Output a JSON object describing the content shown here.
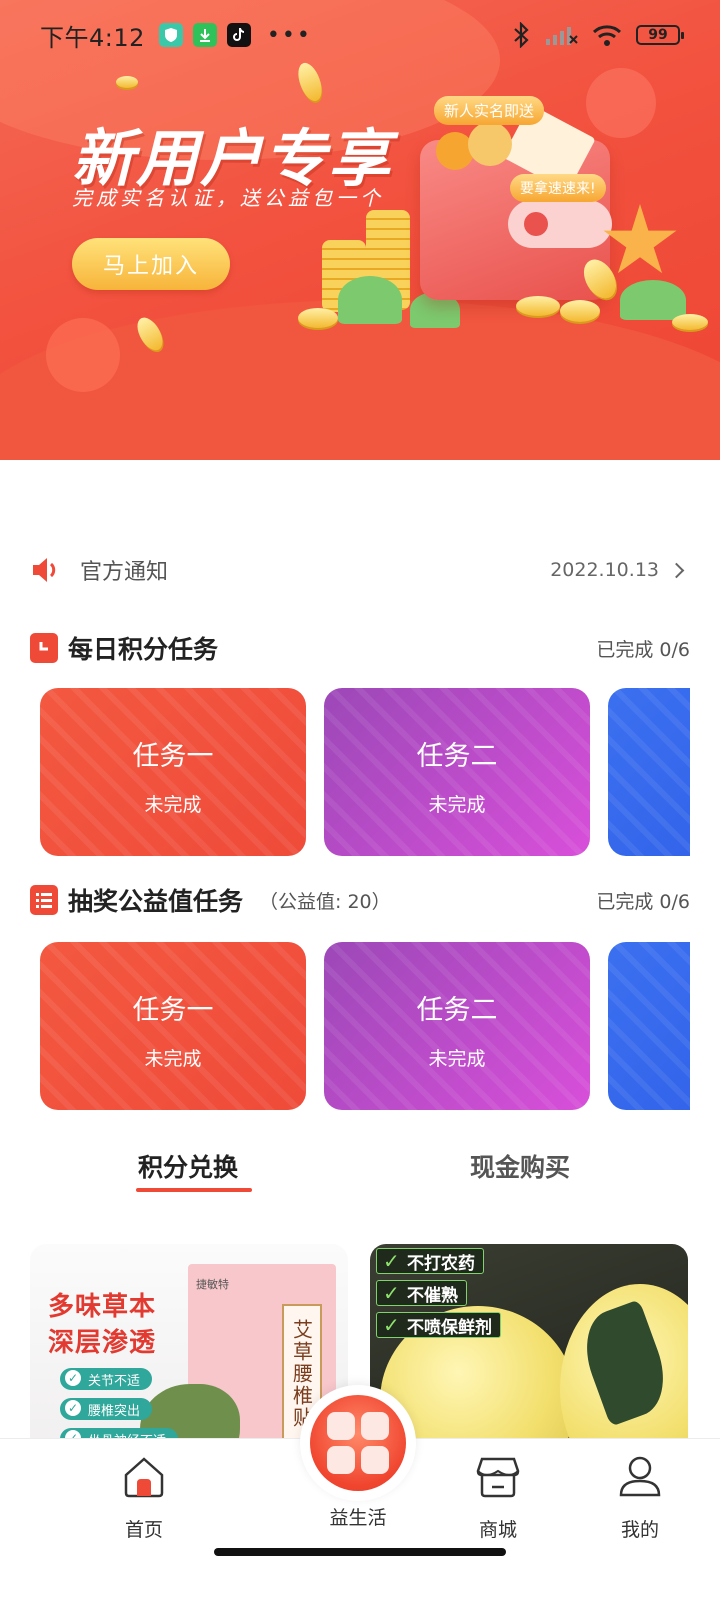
{
  "status_bar": {
    "time": "下午4:12",
    "battery": "99"
  },
  "banner": {
    "title": "新用户专享",
    "subtitle": "完成实名认证，送公益包一个",
    "join_button": "马上加入",
    "tag_new": "新人实名即送",
    "tag_hurry": "要拿速速来!",
    "colors": {
      "primary": "#ef4a38",
      "button": "#f7b43a"
    }
  },
  "notice": {
    "label": "官方通知",
    "date": "2022.10.13"
  },
  "daily_tasks": {
    "title": "每日积分任务",
    "done": "已完成 0/6",
    "cards": [
      {
        "title": "任务一",
        "status": "未完成",
        "color": "#ef4b3a"
      },
      {
        "title": "任务二",
        "status": "未完成",
        "color": "#b94bc9"
      },
      {
        "title": "",
        "status": "",
        "color": "#3b70f0"
      }
    ]
  },
  "lottery_tasks": {
    "title": "抽奖公益值任务",
    "extra": "（公益值: 20）",
    "done": "已完成 0/6",
    "cards": [
      {
        "title": "任务一",
        "status": "未完成",
        "color": "#ef4b3a"
      },
      {
        "title": "任务二",
        "status": "未完成",
        "color": "#b94bc9"
      },
      {
        "title": "",
        "status": "",
        "color": "#3b70f0"
      }
    ]
  },
  "tabs": [
    {
      "label": "积分兑换",
      "active": true
    },
    {
      "label": "现金购买",
      "active": false
    }
  ],
  "products": [
    {
      "headline1": "多味草本",
      "headline2": "深层渗透",
      "features": [
        "关节不适",
        "腰椎突出",
        "坐骨神经不适"
      ],
      "brand": "捷敏特",
      "label": "艾草腰椎贴"
    },
    {
      "checks": [
        "不打农药",
        "不催熟",
        "不喷保鲜剂"
      ]
    }
  ],
  "bottom_nav": [
    {
      "label": "首页",
      "icon": "home-icon"
    },
    {
      "label": "益生活",
      "icon": "apps-icon"
    },
    {
      "label": "商城",
      "icon": "store-icon"
    },
    {
      "label": "我的",
      "icon": "profile-icon"
    }
  ]
}
